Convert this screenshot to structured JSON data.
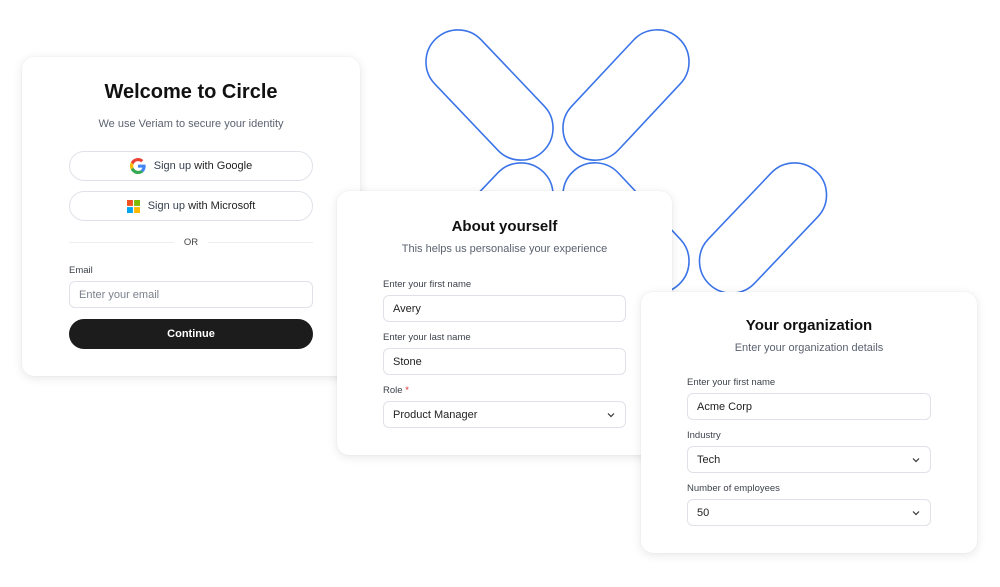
{
  "theme": {
    "accent_stroke": "#3b74e8",
    "primary_button_bg": "#1c1c1c",
    "required_color": "#e03131"
  },
  "welcome_card": {
    "title": "Welcome to Circle",
    "subtitle": "We use Veriam to secure your identity",
    "google_button": {
      "prefix": "Sign up",
      "suffix": "with Google",
      "icon": "google-icon"
    },
    "microsoft_button": {
      "prefix": "Sign up",
      "suffix": "with Microsoft",
      "icon": "microsoft-icon"
    },
    "divider_label": "OR",
    "email": {
      "label": "Email",
      "placeholder": "Enter your email",
      "value": ""
    },
    "continue_label": "Continue"
  },
  "about_card": {
    "title": "About yourself",
    "subtitle": "This helps us personalise your experience",
    "first_name": {
      "label": "Enter your first name",
      "value": "Avery"
    },
    "last_name": {
      "label": "Enter your last name",
      "value": "Stone"
    },
    "role": {
      "label": "Role",
      "required_mark": "*",
      "value": "Product Manager",
      "icon": "chevron-down-icon"
    }
  },
  "org_card": {
    "title": "Your organization",
    "subtitle": "Enter your organization details",
    "org_name": {
      "label": "Enter your first name",
      "value": "Acme Corp"
    },
    "industry": {
      "label": "Industry",
      "value": "Tech",
      "icon": "chevron-down-icon"
    },
    "employees": {
      "label": "Number of employees",
      "value": "50",
      "icon": "chevron-down-icon"
    }
  }
}
